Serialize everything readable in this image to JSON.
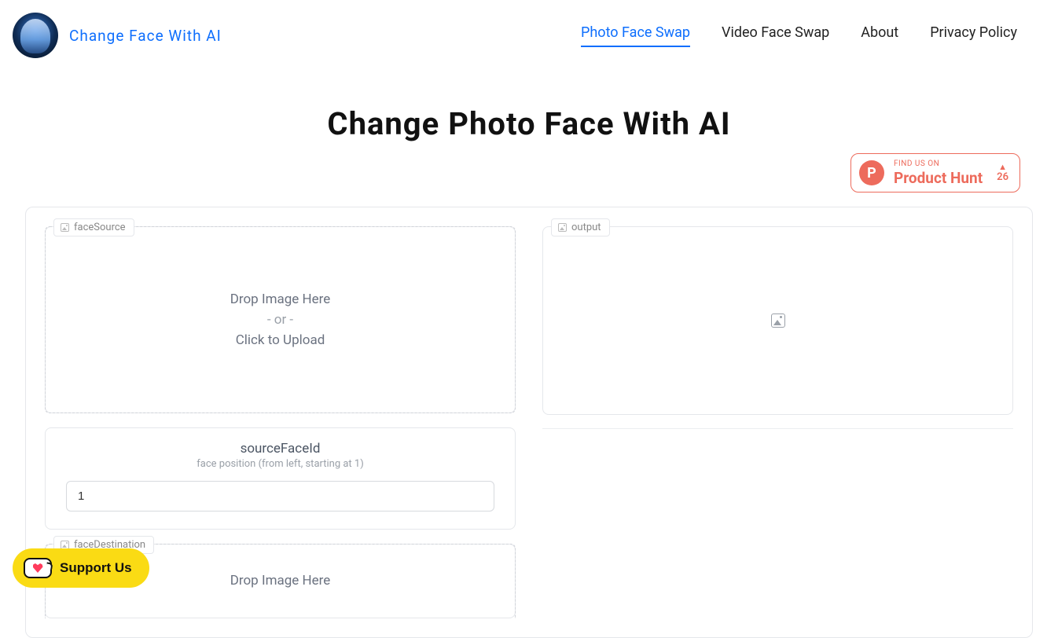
{
  "brand": {
    "title": "Change Face With AI"
  },
  "nav": {
    "items": [
      {
        "label": "Photo Face Swap",
        "active": true
      },
      {
        "label": "Video Face Swap",
        "active": false
      },
      {
        "label": "About",
        "active": false
      },
      {
        "label": "Privacy Policy",
        "active": false
      }
    ]
  },
  "page_title": "Change Photo Face With AI",
  "product_hunt": {
    "letter": "P",
    "top_line": "FIND US ON",
    "bottom_line": "Product Hunt",
    "triangle": "▲",
    "count": "26"
  },
  "left": {
    "face_source": {
      "tag": "faceSource",
      "drop_l1": "Drop Image Here",
      "drop_or": "- or -",
      "drop_l2": "Click to Upload"
    },
    "source_face_id": {
      "label": "sourceFaceId",
      "hint": "face position (from left, starting at 1)",
      "value": "1"
    },
    "face_destination": {
      "tag": "faceDestination",
      "drop_l1": "Drop Image Here"
    }
  },
  "right": {
    "output": {
      "tag": "output"
    }
  },
  "support": {
    "label": "Support Us"
  }
}
